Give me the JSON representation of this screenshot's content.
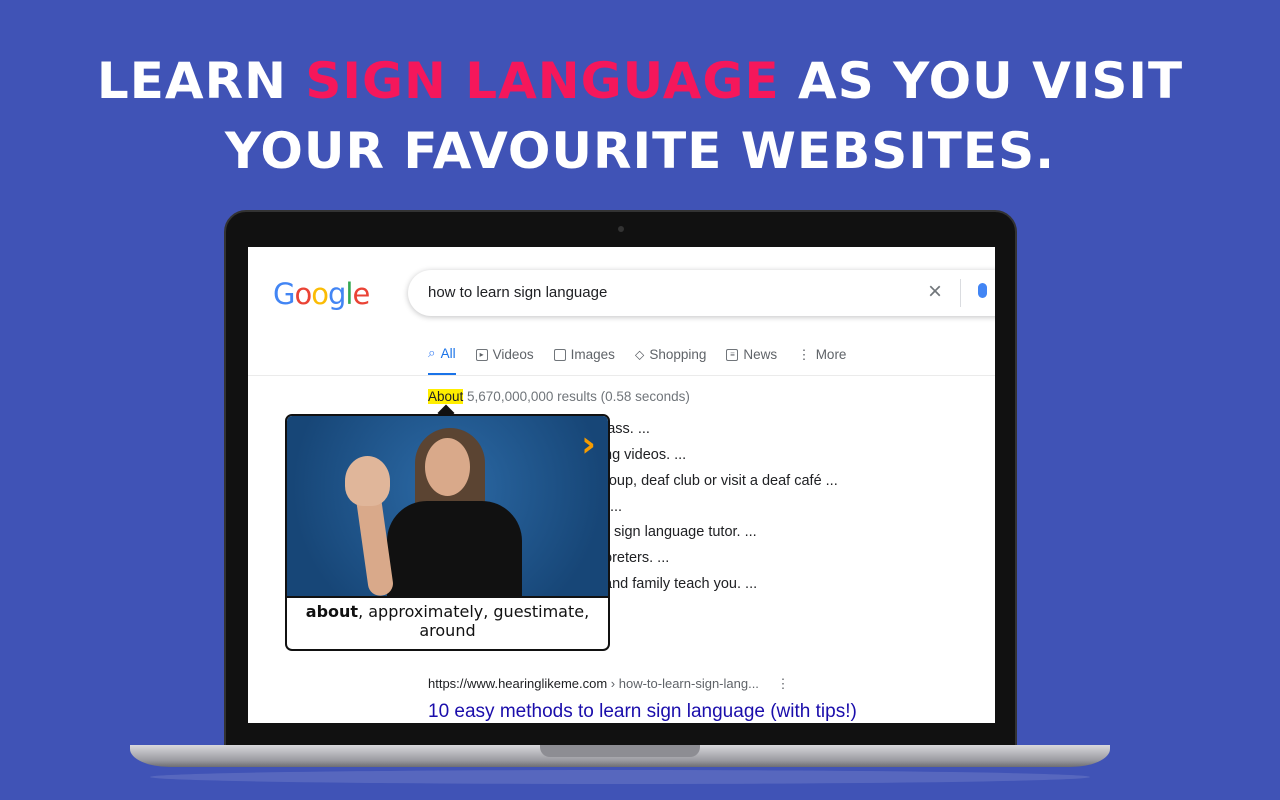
{
  "headline": {
    "line1_pre": "LEARN ",
    "line1_highlight": "SIGN LANGUAGE",
    "line1_post": " AS YOU VISIT",
    "line2": "YOUR FAVOURITE WEBSITES."
  },
  "colors": {
    "background": "#4053b6",
    "highlight": "#f5175b",
    "google_blue": "#1a73e8",
    "link": "#1a0dab",
    "word_highlight": "#ffee00",
    "next_arrow": "#f59b00"
  },
  "google": {
    "logo": "Google",
    "search_value": "how to learn sign language",
    "tabs": [
      {
        "label": "All",
        "icon": "search-icon"
      },
      {
        "label": "Videos",
        "icon": "play-icon"
      },
      {
        "label": "Images",
        "icon": "image-icon"
      },
      {
        "label": "Shopping",
        "icon": "tag-icon"
      },
      {
        "label": "News",
        "icon": "newspaper-icon"
      },
      {
        "label": "More",
        "icon": "more-vertical-icon"
      }
    ],
    "stats_highlight": "About",
    "stats_rest": " 5,670,000,000 results (0.58 seconds)",
    "snippets": [
      "lass. ...",
      "ng videos. ...",
      "roup, deaf club or visit a deaf café ...",
      "...",
      "sign language tutor. ...",
      "oreters. ...",
      "and family teach you. ..."
    ],
    "result": {
      "url": "https://www.hearinglikeme.com",
      "path": " › how-to-learn-sign-lang...",
      "title": "10 easy methods to learn sign language (with tips!)"
    }
  },
  "popup": {
    "word": "about",
    "synonyms": ", approximately, guestimate, around"
  }
}
